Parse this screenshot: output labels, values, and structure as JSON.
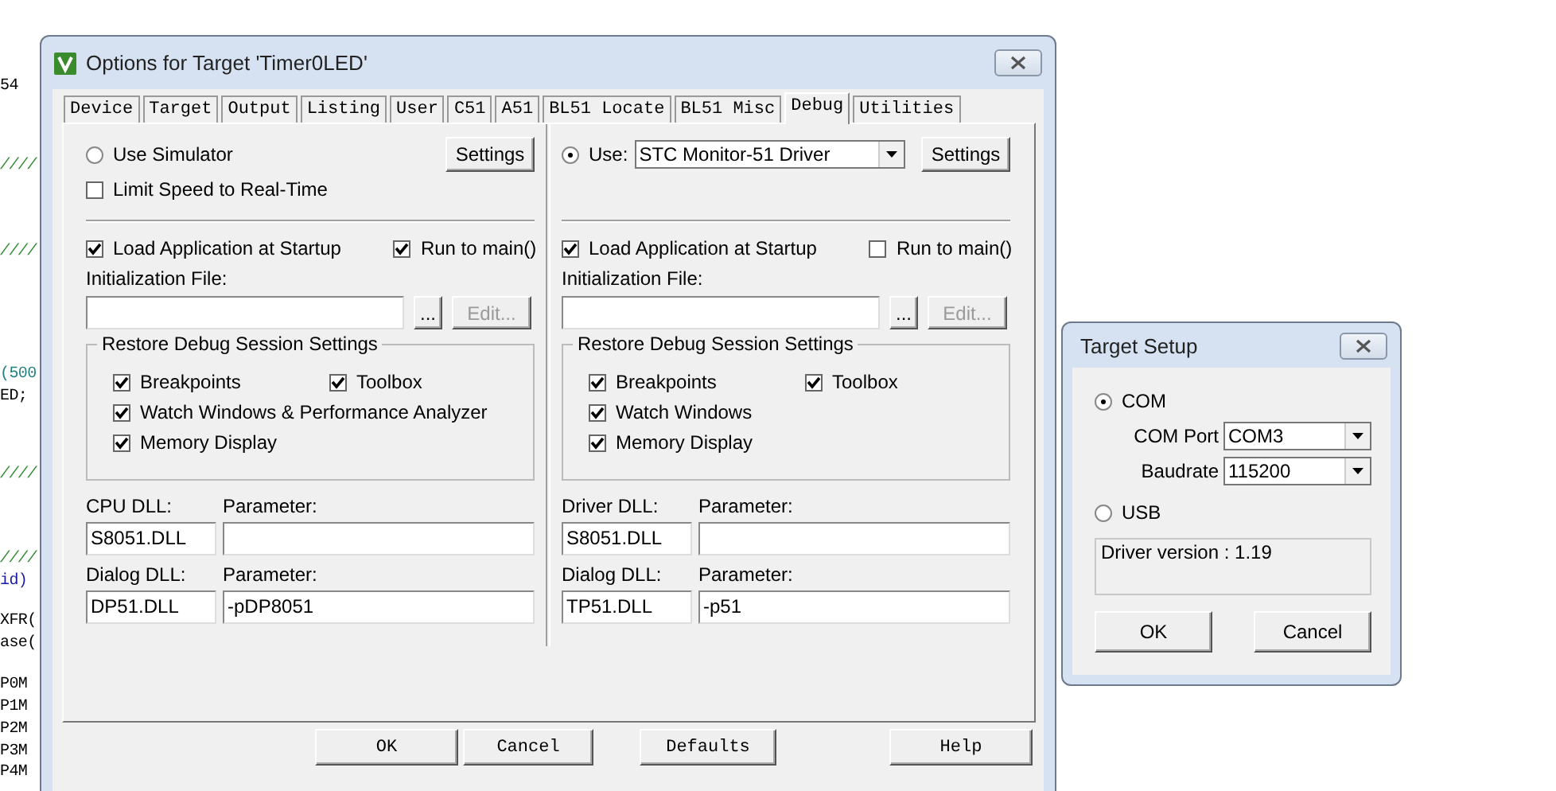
{
  "editor_fragments": [
    {
      "text": "54",
      "kind": "code"
    },
    {
      "text": "////",
      "kind": "comment"
    },
    {
      "text": "////",
      "kind": "comment"
    },
    {
      "text": "(500",
      "kind": "number"
    },
    {
      "text": "ED;",
      "kind": "code"
    },
    {
      "text": "////",
      "kind": "comment"
    },
    {
      "text": "////",
      "kind": "comment"
    },
    {
      "text": "id)",
      "kind": "keyword"
    },
    {
      "text": "XFR(",
      "kind": "code"
    },
    {
      "text": "ase(",
      "kind": "code"
    },
    {
      "text": "P0M",
      "kind": "code"
    },
    {
      "text": "P1M",
      "kind": "code"
    },
    {
      "text": "P2M",
      "kind": "code"
    },
    {
      "text": "P3M",
      "kind": "code"
    },
    {
      "text": "P4M",
      "kind": "code"
    }
  ],
  "options_dialog": {
    "title": "Options for Target 'Timer0LED'",
    "tabs": [
      {
        "label": "Device",
        "selected": false
      },
      {
        "label": "Target",
        "selected": false
      },
      {
        "label": "Output",
        "selected": false
      },
      {
        "label": "Listing",
        "selected": false
      },
      {
        "label": "User",
        "selected": false
      },
      {
        "label": "C51",
        "selected": false
      },
      {
        "label": "A51",
        "selected": false
      },
      {
        "label": "BL51 Locate",
        "selected": false
      },
      {
        "label": "BL51 Misc",
        "selected": false
      },
      {
        "label": "Debug",
        "selected": true
      },
      {
        "label": "Utilities",
        "selected": false
      }
    ],
    "columns": [
      {
        "mode": {
          "kind": "simulator",
          "label": "Use Simulator",
          "selected": false
        },
        "settings_button": "Settings",
        "limit_speed": {
          "label": "Limit Speed to Real-Time",
          "checked": false
        },
        "load_app": {
          "label": "Load Application at Startup",
          "checked": true
        },
        "run_to_main": {
          "label": "Run to main()",
          "checked": true
        },
        "init_file_label": "Initialization File:",
        "browse_button": "...",
        "edit_button": {
          "label": "Edit...",
          "disabled": true
        },
        "restore": {
          "title": "Restore Debug Session Settings",
          "items": [
            {
              "label": "Breakpoints",
              "checked": true
            },
            {
              "label": "Toolbox",
              "checked": true
            },
            {
              "label": "Watch Windows & Performance Analyzer",
              "checked": true
            },
            {
              "label": "Memory Display",
              "checked": true
            }
          ]
        },
        "dll_rows": [
          {
            "label": "CPU DLL:",
            "value": "S8051.DLL",
            "param_label": "Parameter:"
          },
          {
            "label": "Dialog DLL:",
            "value": "DP51.DLL",
            "param_label": "Parameter:",
            "param_value": "-pDP8051"
          }
        ]
      },
      {
        "mode": {
          "kind": "driver",
          "label": "Use:",
          "selected": true,
          "value": "STC Monitor-51 Driver"
        },
        "settings_button": "Settings",
        "load_app": {
          "label": "Load Application at Startup",
          "checked": true
        },
        "run_to_main": {
          "label": "Run to main()",
          "checked": false
        },
        "init_file_label": "Initialization File:",
        "browse_button": "...",
        "edit_button": {
          "label": "Edit...",
          "disabled": true
        },
        "restore": {
          "title": "Restore Debug Session Settings",
          "items": [
            {
              "label": "Breakpoints",
              "checked": true
            },
            {
              "label": "Toolbox",
              "checked": true
            },
            {
              "label": "Watch Windows",
              "checked": true
            },
            {
              "label": "Memory Display",
              "checked": true
            }
          ]
        },
        "dll_rows": [
          {
            "label": "Driver DLL:",
            "value": "S8051.DLL",
            "param_label": "Parameter:"
          },
          {
            "label": "Dialog DLL:",
            "value": "TP51.DLL",
            "param_label": "Parameter:",
            "param_value": "-p51"
          }
        ]
      }
    ],
    "buttons": [
      "OK",
      "Cancel",
      "Defaults",
      "Help"
    ]
  },
  "target_setup": {
    "title": "Target Setup",
    "com": {
      "label": "COM",
      "selected": true
    },
    "fields": [
      {
        "label": "COM Port",
        "value": "COM3"
      },
      {
        "label": "Baudrate",
        "value": "115200"
      }
    ],
    "usb": {
      "label": "USB",
      "selected": false
    },
    "info": "Driver version : 1.19",
    "buttons": [
      "OK",
      "Cancel"
    ]
  }
}
